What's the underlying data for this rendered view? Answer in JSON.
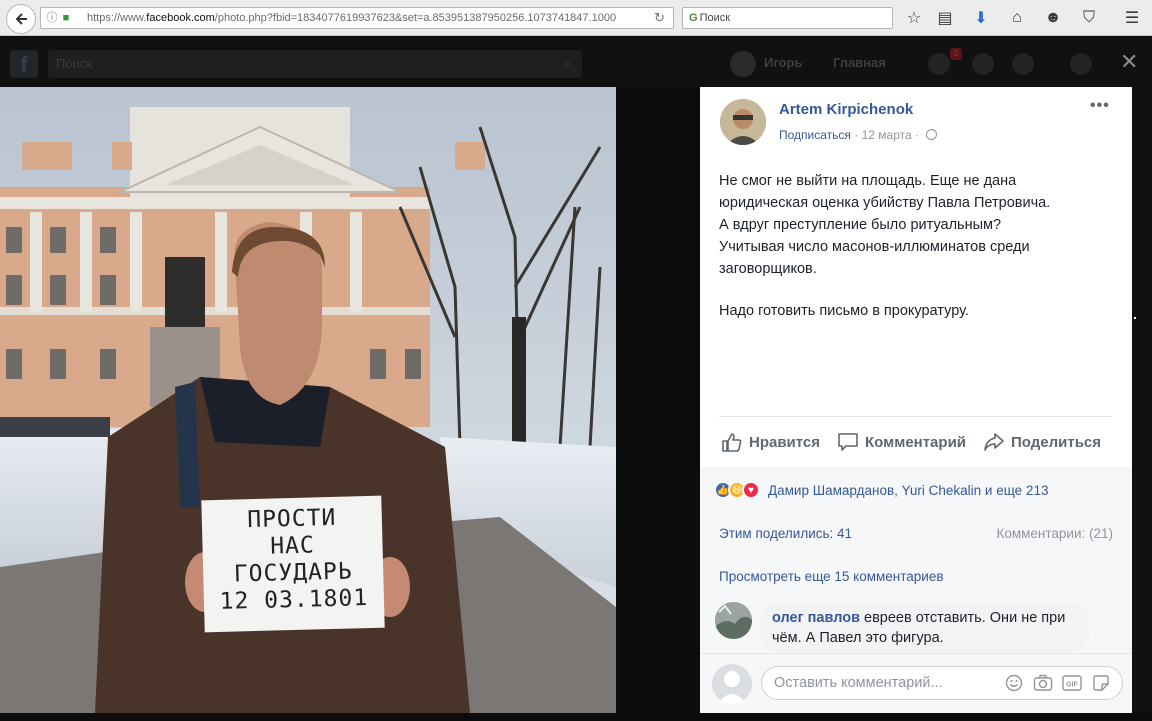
{
  "browser": {
    "url_prefix": "https://www.",
    "url_domain": "facebook.com",
    "url_rest": "/photo.php?fbid=1834077619937623&set=a.853951387950256.1073741847.1000",
    "search_placeholder": "Поиск"
  },
  "fb": {
    "search_placeholder": "Поиск",
    "user_name": "Игорь",
    "home_label": "Главная",
    "notif_count": "2"
  },
  "post": {
    "author": "Artem Kirpichenok",
    "subscribe": "Подписаться",
    "date": "12 марта",
    "text_lines": [
      "Не смог не выйти на площадь. Еще не дана",
      "юридическая оценка убийству Павла Петровича.",
      "А вдруг преступление было ритуальным?",
      "Учитывая число масонов-иллюминатов среди",
      "заговорщиков."
    ],
    "text_p2": "Надо готовить письмо в прокуратуру."
  },
  "actions": {
    "like": "Нравится",
    "comment": "Комментарий",
    "share": "Поделиться"
  },
  "stats": {
    "reactions_text": "Дамир Шамарданов, Yuri Chekalin и еще 213",
    "shares": "Этим поделились: 41",
    "comments": "Комментарии: (21)",
    "view_more": "Просмотреть еще 15 комментариев"
  },
  "comment": {
    "name": "олег павлов",
    "text": "евреев отставить. Они не при чём. А Павел это фигура."
  },
  "composer": {
    "placeholder": "Оставить комментарий..."
  },
  "sign": {
    "line1": "ПРОСТИ",
    "line2": "НАС",
    "line3": "ГОСУДАРЬ",
    "line4": "12 03.1801"
  },
  "colors": {
    "link": "#365899",
    "like_blue": "#4267b2",
    "haha_yellow": "#f7b125",
    "love_red": "#f0284a"
  }
}
